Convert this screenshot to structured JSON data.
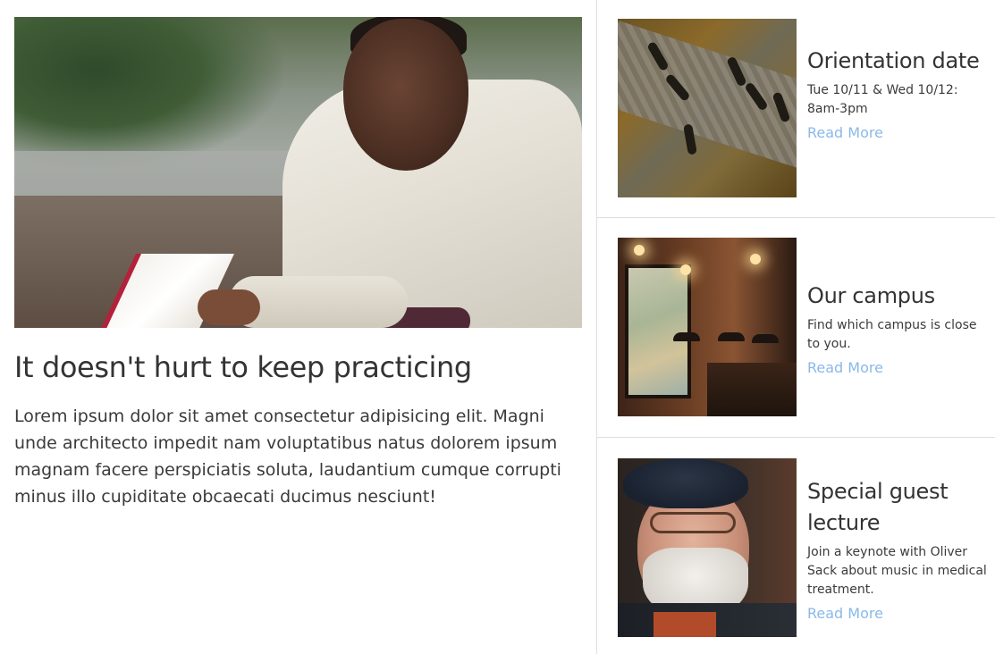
{
  "feature": {
    "image_alt": "Man in white sweater reading a book outdoors",
    "title": "It doesn't hurt to keep practicing",
    "text": "Lorem ipsum dolor sit amet consectetur adipisicing elit. Magni unde architecto impedit nam voluptatibus natus dolorem ipsum magnam facere perspiciatis soluta, laudantium cumque corrupti minus illo cupiditate obcaecati ducimus nesciunt!"
  },
  "cards": [
    {
      "title": "Orientation date",
      "text": "Tue 10/11 & Wed 10/12: 8am-3pm",
      "link": "Read More"
    },
    {
      "title": "Our campus",
      "text": "Find which campus is close to you.",
      "link": "Read More"
    },
    {
      "title": "Special guest lecture",
      "text": "Join a keynote with Oliver Sack about music in medical treatment.",
      "link": "Read More"
    }
  ],
  "colors": {
    "link": "#89b9e8",
    "text": "#333333",
    "divider": "#dedede"
  }
}
